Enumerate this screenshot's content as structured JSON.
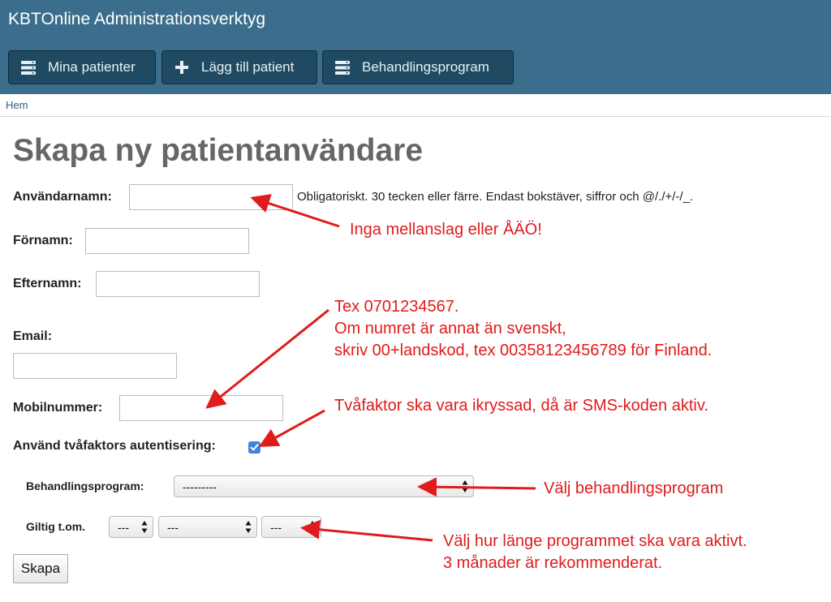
{
  "header": {
    "title": "KBTOnline Administrationsverktyg",
    "nav": [
      {
        "label": "Mina patienter",
        "icon": "server-list-icon"
      },
      {
        "label": "Lägg till patient",
        "icon": "plus-icon"
      },
      {
        "label": "Behandlingsprogram",
        "icon": "server-list-icon"
      }
    ]
  },
  "breadcrumb": {
    "home": "Hem"
  },
  "page": {
    "title": "Skapa ny patientanvändare"
  },
  "form": {
    "username": {
      "label": "Användarnamn:",
      "value": "",
      "help": "Obligatoriskt. 30 tecken eller färre. Endast bokstäver, siffror och @/./+/-/_."
    },
    "first_name": {
      "label": "Förnamn:",
      "value": ""
    },
    "last_name": {
      "label": "Efternamn:",
      "value": ""
    },
    "email": {
      "label": "Email:",
      "value": ""
    },
    "mobile": {
      "label": "Mobilnummer:",
      "value": ""
    },
    "two_factor": {
      "label": "Använd tvåfaktors autentisering:",
      "checked": true
    },
    "program": {
      "label": "Behandlingsprogram:",
      "selected": "---------"
    },
    "valid_until": {
      "label": "Giltig t.om.",
      "day": "---",
      "month": "---",
      "year": "---"
    },
    "submit": "Skapa"
  },
  "annotations": {
    "username_note": "Inga mellanslag eller ÅÄÖ!",
    "mobile_note_1": "Tex 0701234567.",
    "mobile_note_2": "Om numret är annat än svenskt,",
    "mobile_note_3": "skriv 00+landskod, tex 00358123456789 för Finland.",
    "two_factor_note": "Tvåfaktor ska vara ikryssad, då är SMS-koden aktiv.",
    "program_note": "Välj behandlingsprogram",
    "valid_note_1": "Välj hur länge programmet ska vara aktivt.",
    "valid_note_2": "3 månader är rekommenderat."
  },
  "colors": {
    "header": "#3b6e8c",
    "nav_button": "#1f4a62",
    "annotation": "#e01b1b",
    "checkbox": "#3b84e0"
  }
}
